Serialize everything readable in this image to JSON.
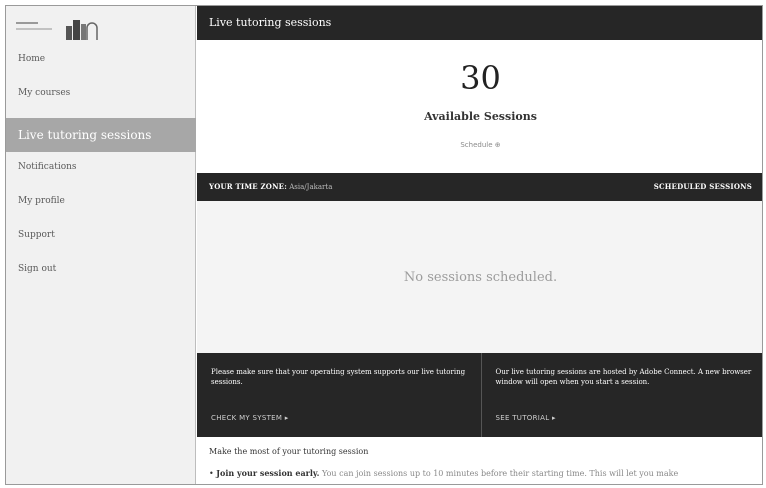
{
  "app": {
    "title": "Live tutoring sessions"
  },
  "sidebar": {
    "items": [
      {
        "label": "Home"
      },
      {
        "label": "My courses"
      },
      {
        "label": "Live tutoring sessions",
        "active": true
      },
      {
        "label": "Notifications"
      },
      {
        "label": "My profile"
      },
      {
        "label": "Support"
      },
      {
        "label": "Sign out"
      }
    ]
  },
  "summary": {
    "count": "30",
    "count_label": "Available Sessions",
    "schedule_link": "Schedule ⊕"
  },
  "timezone_bar": {
    "label": "YOUR TIME ZONE:",
    "value": "Asia/Jakarta",
    "scheduled_link": "SCHEDULED SESSIONS"
  },
  "empty_state": {
    "message": "No sessions scheduled."
  },
  "info": {
    "left": {
      "text": "Please make sure that your operating system supports our live tutoring sessions.",
      "link": "CHECK MY SYSTEM ▸"
    },
    "right": {
      "text": "Our live tutoring sessions are hosted by Adobe Connect. A new browser window will open when you start a session.",
      "link": "SEE TUTORIAL ▸"
    }
  },
  "tips": {
    "heading": "Make the most of your tutoring session",
    "items": [
      {
        "bold": "Join your session early.",
        "rest": " You can join sessions up to 10 minutes before their starting time. This will let you make"
      }
    ]
  },
  "colors": {
    "dark_bar": "#262626",
    "active_nav": "#a7a7a7",
    "sidebar_bg": "#f1f1f1",
    "empty_bg": "#f4f4f4"
  }
}
